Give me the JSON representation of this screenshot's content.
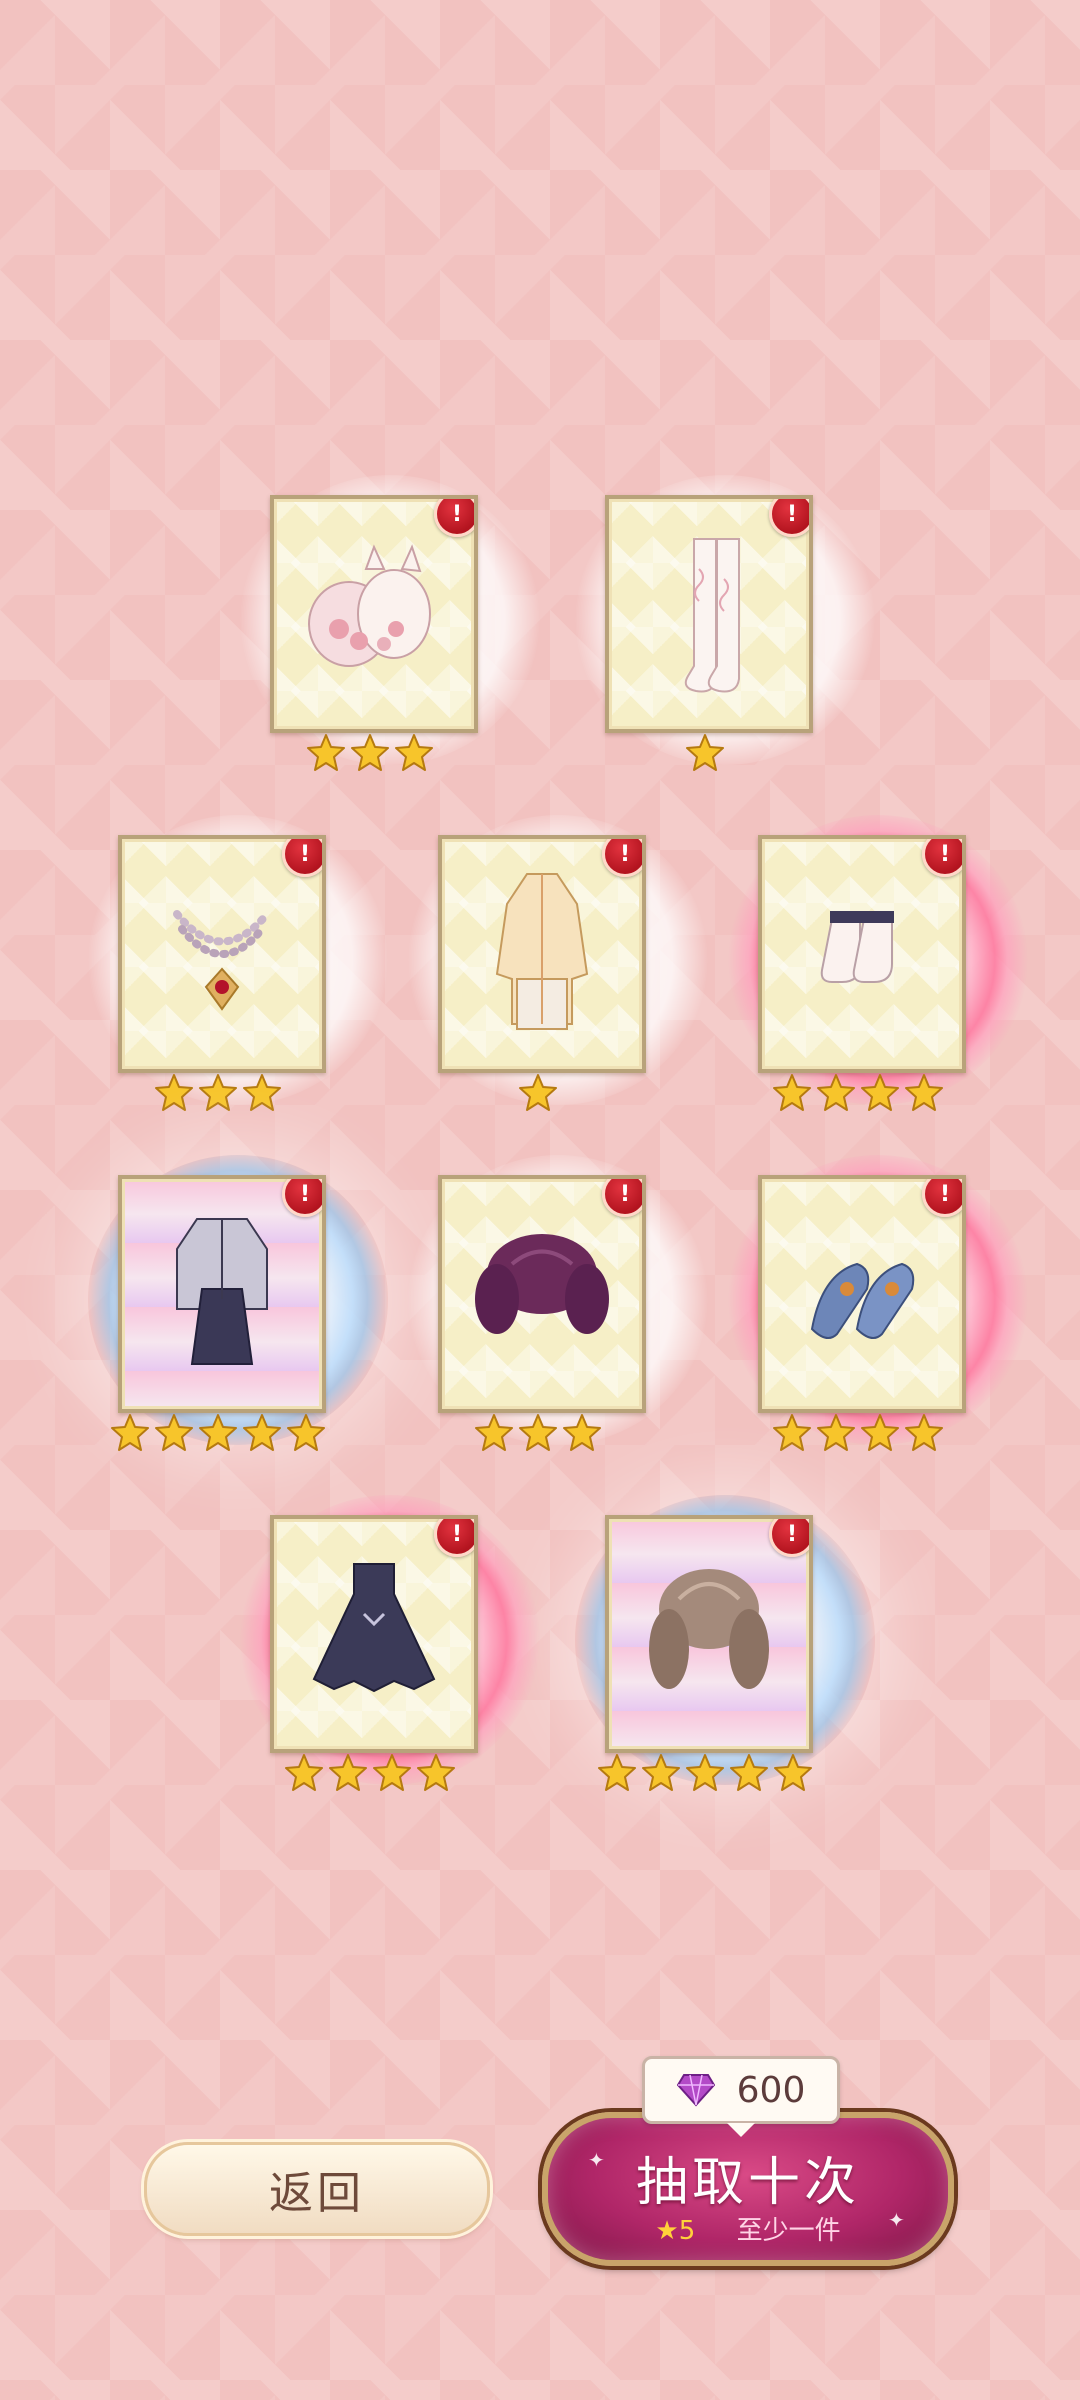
{
  "items": [
    {
      "id": "bunny-bag",
      "stars": 3,
      "badge": "!"
    },
    {
      "id": "stockings",
      "stars": 1,
      "badge": "!"
    },
    {
      "id": "pearl-necklace",
      "stars": 3,
      "badge": "!"
    },
    {
      "id": "qipao-dress",
      "stars": 1,
      "badge": "!"
    },
    {
      "id": "frill-socks",
      "stars": 4,
      "badge": "!"
    },
    {
      "id": "dark-coat-skirt",
      "stars": 5,
      "badge": "!"
    },
    {
      "id": "purple-curly-hair",
      "stars": 3,
      "badge": "!"
    },
    {
      "id": "blue-shoes",
      "stars": 4,
      "badge": "!"
    },
    {
      "id": "black-lolita-dress",
      "stars": 4,
      "badge": "!"
    },
    {
      "id": "brown-curly-hair",
      "stars": 5,
      "badge": "!"
    }
  ],
  "cost": {
    "value": "600",
    "icon": "diamond-icon"
  },
  "buttons": {
    "back_label": "返回",
    "draw_label": "抽取十次",
    "draw_star": "★5",
    "draw_guarantee": "至少一件"
  },
  "colors": {
    "background": "#f2c2c0",
    "card_frame": "#b8a27a",
    "badge_red": "#c41c28",
    "draw_button": "#b02668",
    "star_gold": "#f7c52b"
  }
}
